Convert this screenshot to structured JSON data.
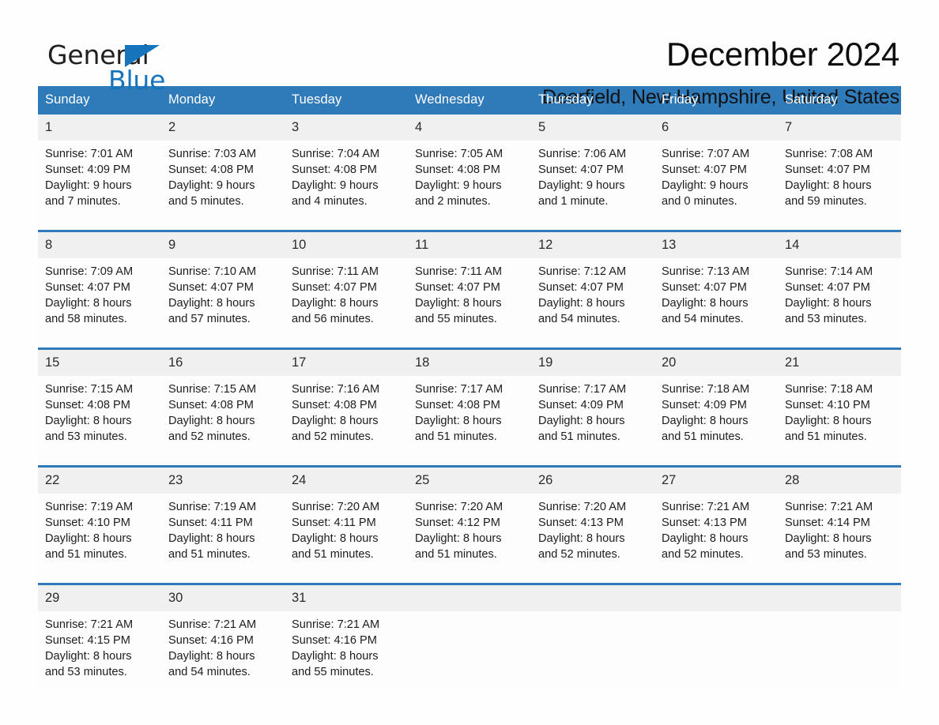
{
  "logo": {
    "word_general": "General",
    "word_blue": "Blue",
    "triangle_color": "#1574bb"
  },
  "header": {
    "title": "December 2024",
    "subtitle": "Deerfield, New Hampshire, United States"
  },
  "theme": {
    "header_blue": "#2f7ab9",
    "daynum_band": "#f0f0f0",
    "page_background": "#fefefe"
  },
  "calendar": {
    "weekday_headers": [
      "Sunday",
      "Monday",
      "Tuesday",
      "Wednesday",
      "Thursday",
      "Friday",
      "Saturday"
    ],
    "weeks": [
      [
        {
          "day": "1",
          "sunrise": "Sunrise: 7:01 AM",
          "sunset": "Sunset: 4:09 PM",
          "daylight1": "Daylight: 9 hours",
          "daylight2": "and 7 minutes."
        },
        {
          "day": "2",
          "sunrise": "Sunrise: 7:03 AM",
          "sunset": "Sunset: 4:08 PM",
          "daylight1": "Daylight: 9 hours",
          "daylight2": "and 5 minutes."
        },
        {
          "day": "3",
          "sunrise": "Sunrise: 7:04 AM",
          "sunset": "Sunset: 4:08 PM",
          "daylight1": "Daylight: 9 hours",
          "daylight2": "and 4 minutes."
        },
        {
          "day": "4",
          "sunrise": "Sunrise: 7:05 AM",
          "sunset": "Sunset: 4:08 PM",
          "daylight1": "Daylight: 9 hours",
          "daylight2": "and 2 minutes."
        },
        {
          "day": "5",
          "sunrise": "Sunrise: 7:06 AM",
          "sunset": "Sunset: 4:07 PM",
          "daylight1": "Daylight: 9 hours",
          "daylight2": "and 1 minute."
        },
        {
          "day": "6",
          "sunrise": "Sunrise: 7:07 AM",
          "sunset": "Sunset: 4:07 PM",
          "daylight1": "Daylight: 9 hours",
          "daylight2": "and 0 minutes."
        },
        {
          "day": "7",
          "sunrise": "Sunrise: 7:08 AM",
          "sunset": "Sunset: 4:07 PM",
          "daylight1": "Daylight: 8 hours",
          "daylight2": "and 59 minutes."
        }
      ],
      [
        {
          "day": "8",
          "sunrise": "Sunrise: 7:09 AM",
          "sunset": "Sunset: 4:07 PM",
          "daylight1": "Daylight: 8 hours",
          "daylight2": "and 58 minutes."
        },
        {
          "day": "9",
          "sunrise": "Sunrise: 7:10 AM",
          "sunset": "Sunset: 4:07 PM",
          "daylight1": "Daylight: 8 hours",
          "daylight2": "and 57 minutes."
        },
        {
          "day": "10",
          "sunrise": "Sunrise: 7:11 AM",
          "sunset": "Sunset: 4:07 PM",
          "daylight1": "Daylight: 8 hours",
          "daylight2": "and 56 minutes."
        },
        {
          "day": "11",
          "sunrise": "Sunrise: 7:11 AM",
          "sunset": "Sunset: 4:07 PM",
          "daylight1": "Daylight: 8 hours",
          "daylight2": "and 55 minutes."
        },
        {
          "day": "12",
          "sunrise": "Sunrise: 7:12 AM",
          "sunset": "Sunset: 4:07 PM",
          "daylight1": "Daylight: 8 hours",
          "daylight2": "and 54 minutes."
        },
        {
          "day": "13",
          "sunrise": "Sunrise: 7:13 AM",
          "sunset": "Sunset: 4:07 PM",
          "daylight1": "Daylight: 8 hours",
          "daylight2": "and 54 minutes."
        },
        {
          "day": "14",
          "sunrise": "Sunrise: 7:14 AM",
          "sunset": "Sunset: 4:07 PM",
          "daylight1": "Daylight: 8 hours",
          "daylight2": "and 53 minutes."
        }
      ],
      [
        {
          "day": "15",
          "sunrise": "Sunrise: 7:15 AM",
          "sunset": "Sunset: 4:08 PM",
          "daylight1": "Daylight: 8 hours",
          "daylight2": "and 53 minutes."
        },
        {
          "day": "16",
          "sunrise": "Sunrise: 7:15 AM",
          "sunset": "Sunset: 4:08 PM",
          "daylight1": "Daylight: 8 hours",
          "daylight2": "and 52 minutes."
        },
        {
          "day": "17",
          "sunrise": "Sunrise: 7:16 AM",
          "sunset": "Sunset: 4:08 PM",
          "daylight1": "Daylight: 8 hours",
          "daylight2": "and 52 minutes."
        },
        {
          "day": "18",
          "sunrise": "Sunrise: 7:17 AM",
          "sunset": "Sunset: 4:08 PM",
          "daylight1": "Daylight: 8 hours",
          "daylight2": "and 51 minutes."
        },
        {
          "day": "19",
          "sunrise": "Sunrise: 7:17 AM",
          "sunset": "Sunset: 4:09 PM",
          "daylight1": "Daylight: 8 hours",
          "daylight2": "and 51 minutes."
        },
        {
          "day": "20",
          "sunrise": "Sunrise: 7:18 AM",
          "sunset": "Sunset: 4:09 PM",
          "daylight1": "Daylight: 8 hours",
          "daylight2": "and 51 minutes."
        },
        {
          "day": "21",
          "sunrise": "Sunrise: 7:18 AM",
          "sunset": "Sunset: 4:10 PM",
          "daylight1": "Daylight: 8 hours",
          "daylight2": "and 51 minutes."
        }
      ],
      [
        {
          "day": "22",
          "sunrise": "Sunrise: 7:19 AM",
          "sunset": "Sunset: 4:10 PM",
          "daylight1": "Daylight: 8 hours",
          "daylight2": "and 51 minutes."
        },
        {
          "day": "23",
          "sunrise": "Sunrise: 7:19 AM",
          "sunset": "Sunset: 4:11 PM",
          "daylight1": "Daylight: 8 hours",
          "daylight2": "and 51 minutes."
        },
        {
          "day": "24",
          "sunrise": "Sunrise: 7:20 AM",
          "sunset": "Sunset: 4:11 PM",
          "daylight1": "Daylight: 8 hours",
          "daylight2": "and 51 minutes."
        },
        {
          "day": "25",
          "sunrise": "Sunrise: 7:20 AM",
          "sunset": "Sunset: 4:12 PM",
          "daylight1": "Daylight: 8 hours",
          "daylight2": "and 51 minutes."
        },
        {
          "day": "26",
          "sunrise": "Sunrise: 7:20 AM",
          "sunset": "Sunset: 4:13 PM",
          "daylight1": "Daylight: 8 hours",
          "daylight2": "and 52 minutes."
        },
        {
          "day": "27",
          "sunrise": "Sunrise: 7:21 AM",
          "sunset": "Sunset: 4:13 PM",
          "daylight1": "Daylight: 8 hours",
          "daylight2": "and 52 minutes."
        },
        {
          "day": "28",
          "sunrise": "Sunrise: 7:21 AM",
          "sunset": "Sunset: 4:14 PM",
          "daylight1": "Daylight: 8 hours",
          "daylight2": "and 53 minutes."
        }
      ],
      [
        {
          "day": "29",
          "sunrise": "Sunrise: 7:21 AM",
          "sunset": "Sunset: 4:15 PM",
          "daylight1": "Daylight: 8 hours",
          "daylight2": "and 53 minutes."
        },
        {
          "day": "30",
          "sunrise": "Sunrise: 7:21 AM",
          "sunset": "Sunset: 4:16 PM",
          "daylight1": "Daylight: 8 hours",
          "daylight2": "and 54 minutes."
        },
        {
          "day": "31",
          "sunrise": "Sunrise: 7:21 AM",
          "sunset": "Sunset: 4:16 PM",
          "daylight1": "Daylight: 8 hours",
          "daylight2": "and 55 minutes."
        },
        {
          "day": "",
          "sunrise": "",
          "sunset": "",
          "daylight1": "",
          "daylight2": ""
        },
        {
          "day": "",
          "sunrise": "",
          "sunset": "",
          "daylight1": "",
          "daylight2": ""
        },
        {
          "day": "",
          "sunrise": "",
          "sunset": "",
          "daylight1": "",
          "daylight2": ""
        },
        {
          "day": "",
          "sunrise": "",
          "sunset": "",
          "daylight1": "",
          "daylight2": ""
        }
      ]
    ]
  }
}
